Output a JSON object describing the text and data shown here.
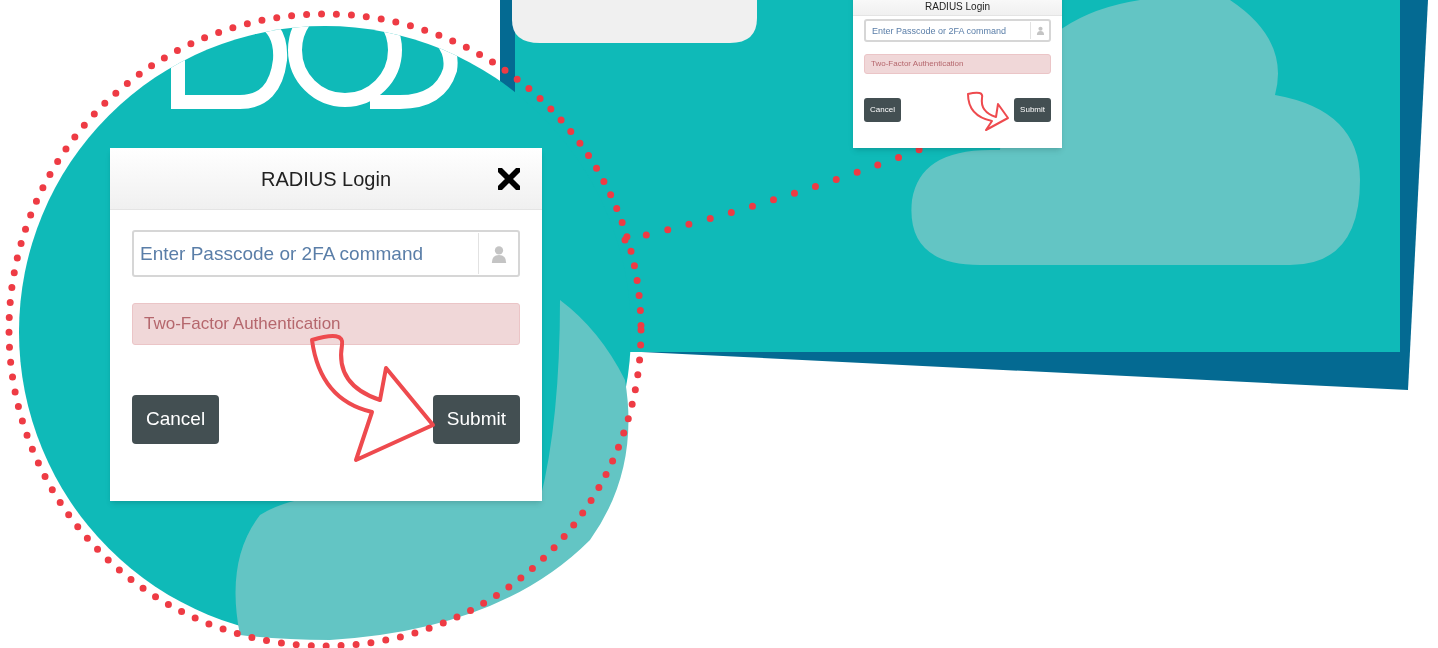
{
  "screen_dialog": {
    "title": "RADIUS Login",
    "passcode_field": {
      "placeholder": "Enter Passcode or 2FA command"
    },
    "message": "Two-Factor Authentication",
    "buttons": [
      "Cancel",
      "Submit"
    ]
  },
  "magnified_dialog": {
    "title": "RADIUS Login",
    "passcode_field": {
      "placeholder": "Enter Passcode or 2FA command"
    },
    "message": "Two-Factor Authentication",
    "buttons": [
      "Cancel",
      "Submit"
    ]
  }
}
